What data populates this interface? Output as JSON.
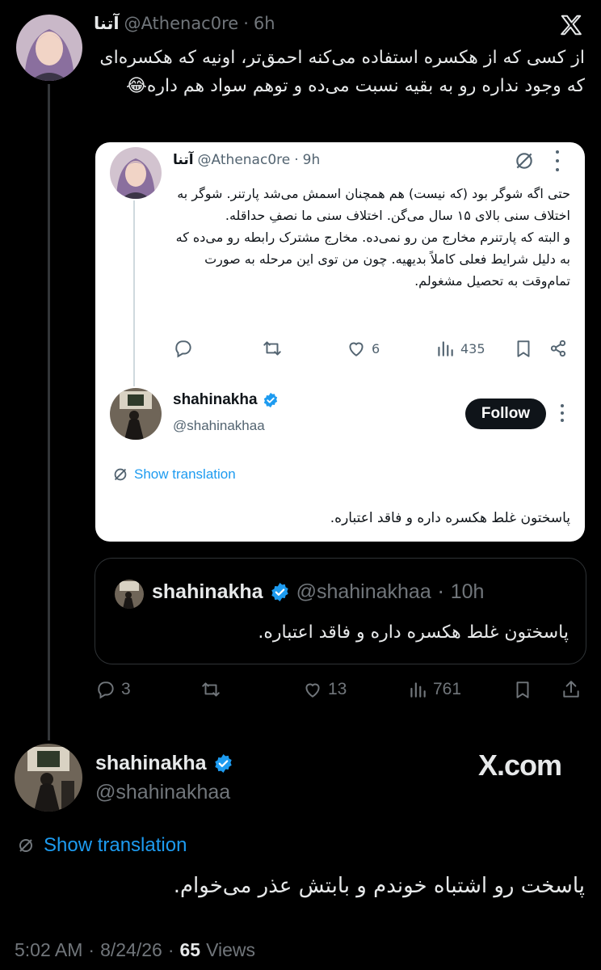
{
  "main_tweet": {
    "display_name": "آتنا",
    "handle": "@Athenac0re",
    "separator": "·",
    "time": "6h",
    "text": "از کسی که از هکسره استفاده می‌کنه احمق‌تر، اونیه که هکسره‌ای که وجود نداره رو به بقیه نسبت می‌ده و توهم سواد هم داره😂"
  },
  "screenshot_card": {
    "tweet": {
      "display_name": "آتنا",
      "handle": "@Athenac0re",
      "separator": "·",
      "time": "9h",
      "text": "حتی اگه شوگر بود (که نیست) هم همچنان اسمش می‌شد پارتنر. شوگر به اختلاف سنی بالای ۱۵ سال می‌گن. اختلاف سنی ما نصفِ حداقله.\nو البته که پارتنرم مخارج من رو نمی‌ده. مخارج مشترک رابطه رو می‌ده که به دلیل شرایط فعلی کاملاً بدیهیه. چون من توی این مرحله به صورت تمام‌وقت به تحصیل مشغولم.",
      "likes": "6",
      "views": "435"
    },
    "reply": {
      "display_name": "shahinakha",
      "handle": "@shahinakhaa",
      "follow_label": "Follow",
      "show_translation": "Show translation",
      "text": "پاسختون غلط هکسره داره و فاقد اعتباره."
    }
  },
  "quoted_tweet": {
    "display_name": "shahinakha",
    "handle": "@shahinakhaa",
    "separator": "·",
    "time": "10h",
    "text": "پاسختون غلط هکسره داره و فاقد اعتباره."
  },
  "main_actions": {
    "replies": "3",
    "likes": "13",
    "views": "761"
  },
  "reply_tweet": {
    "display_name": "shahinakha",
    "handle": "@shahinakhaa",
    "watermark": "X.com",
    "show_translation": "Show translation",
    "text": "پاسخت رو اشتباه خوندم و بابتش عذر می‌خوام.",
    "time": "5:02 AM",
    "separator": "·",
    "date": "8/24/26",
    "views_count": "65",
    "views_label": "Views"
  },
  "colors": {
    "background": "#000000",
    "text": "#e7e9ea",
    "muted": "#71767b",
    "link": "#1d9bf0",
    "verified": "#1d9bf0",
    "card": "#ffffff"
  }
}
